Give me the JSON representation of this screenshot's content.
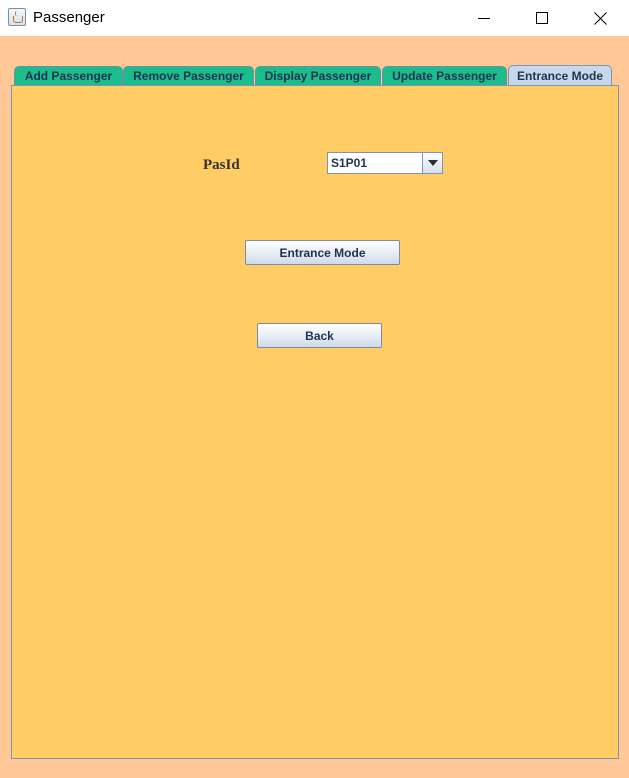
{
  "window": {
    "title": "Passenger",
    "controls": {
      "minimize": "minimize-icon",
      "maximize": "maximize-icon",
      "close": "close-icon"
    }
  },
  "tabs": [
    {
      "label": "Add Passenger",
      "selected": false
    },
    {
      "label": "Remove Passenger",
      "selected": false
    },
    {
      "label": "Display Passenger",
      "selected": false
    },
    {
      "label": "Update Passenger",
      "selected": false
    },
    {
      "label": "Entrance Mode",
      "selected": true
    }
  ],
  "form": {
    "pasid_label": "PasId",
    "pasid_value": "S1P01",
    "entrance_button": "Entrance Mode",
    "back_button": "Back"
  },
  "colors": {
    "window_bg": "#ffc896",
    "panel_bg": "#ffcc66",
    "tab_bg": "#1bbd8c",
    "tab_selected_bg": "#c8d8ea"
  }
}
